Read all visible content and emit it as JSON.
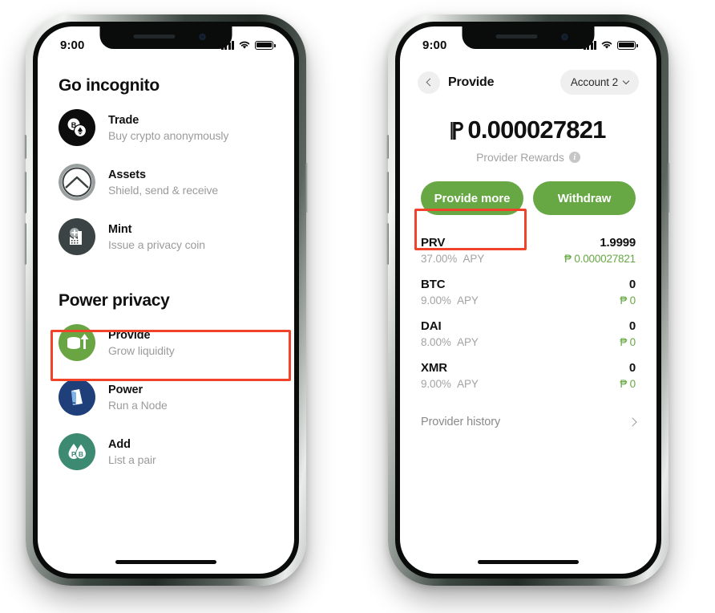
{
  "status_bar": {
    "time": "9:00"
  },
  "left_screen": {
    "sections": [
      {
        "title": "Go incognito",
        "items": [
          {
            "icon": "trade-coins-icon",
            "title": "Trade",
            "subtitle": "Buy crypto anonymously",
            "icon_bg": "#0d0d0d"
          },
          {
            "icon": "assets-shield-icon",
            "title": "Assets",
            "subtitle": "Shield, send & receive",
            "icon_bg": "#8d9291"
          },
          {
            "icon": "mint-factory-icon",
            "title": "Mint",
            "subtitle": "Issue a privacy coin",
            "icon_bg": "#3c4344"
          }
        ]
      },
      {
        "title": "Power privacy",
        "items": [
          {
            "icon": "provide-coins-up-icon",
            "title": "Provide",
            "subtitle": "Grow liquidity",
            "icon_bg": "#6aa543"
          },
          {
            "icon": "power-node-icon",
            "title": "Power",
            "subtitle": "Run a Node",
            "icon_bg": "#1e3f79"
          },
          {
            "icon": "add-pair-droplets-icon",
            "title": "Add",
            "subtitle": "List a pair",
            "icon_bg": "#3c8a72"
          }
        ]
      }
    ],
    "highlight": {
      "target": "Provide",
      "color": "#f0432a"
    }
  },
  "right_screen": {
    "nav": {
      "back_icon": "chevron-left-icon",
      "title": "Provide",
      "account": "Account 2",
      "account_chevron": "chevron-down-icon"
    },
    "balance": {
      "symbol": "₱",
      "amount": "0.000027821",
      "label": "Provider Rewards",
      "info_icon": "info-icon"
    },
    "actions": [
      {
        "label": "Provide more",
        "color": "#67a844",
        "highlighted": true
      },
      {
        "label": "Withdraw",
        "color": "#67a844",
        "highlighted": false
      }
    ],
    "assets": [
      {
        "symbol": "PRV",
        "apy": "37.00%",
        "apy_suffix": "APY",
        "amount": "1.9999",
        "value": "₱ 0.000027821"
      },
      {
        "symbol": "BTC",
        "apy": "9.00%",
        "apy_suffix": "APY",
        "amount": "0",
        "value": "₱ 0"
      },
      {
        "symbol": "DAI",
        "apy": "8.00%",
        "apy_suffix": "APY",
        "amount": "0",
        "value": "₱ 0"
      },
      {
        "symbol": "XMR",
        "apy": "9.00%",
        "apy_suffix": "APY",
        "amount": "0",
        "value": "₱ 0"
      }
    ],
    "history": {
      "label": "Provider history",
      "chevron": "chevron-right-icon"
    },
    "highlight": {
      "target": "Provide more",
      "color": "#f0432a"
    }
  }
}
